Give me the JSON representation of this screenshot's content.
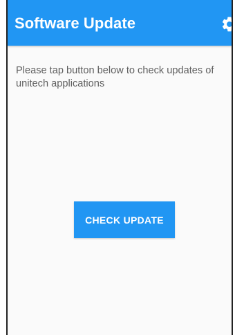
{
  "app_bar": {
    "title": "Software Update",
    "settings_icon": "gear-icon"
  },
  "main": {
    "message": "Please tap button below to check updates of unitech applications",
    "check_button_label": "CHECK UPDATE"
  },
  "colors": {
    "primary": "#2196f3",
    "background": "#fafafa",
    "text_secondary": "#5f5f5f"
  }
}
